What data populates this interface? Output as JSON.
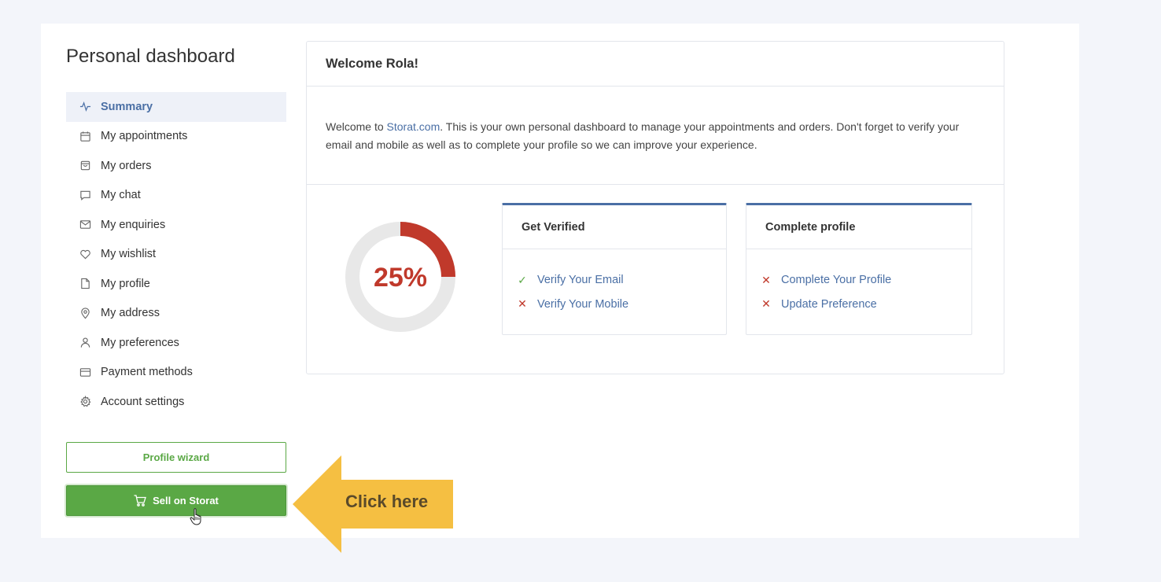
{
  "sidebar": {
    "title": "Personal dashboard",
    "items": [
      {
        "label": "Summary",
        "icon": "activity-icon",
        "active": true
      },
      {
        "label": "My appointments",
        "icon": "calendar-icon"
      },
      {
        "label": "My orders",
        "icon": "shopping-bag-icon"
      },
      {
        "label": "My chat",
        "icon": "chat-icon"
      },
      {
        "label": "My enquiries",
        "icon": "mail-icon"
      },
      {
        "label": "My wishlist",
        "icon": "heart-icon"
      },
      {
        "label": "My profile",
        "icon": "file-icon"
      },
      {
        "label": "My address",
        "icon": "map-pin-icon"
      },
      {
        "label": "My preferences",
        "icon": "user-icon"
      },
      {
        "label": "Payment methods",
        "icon": "credit-card-icon"
      },
      {
        "label": "Account settings",
        "icon": "gear-icon"
      }
    ],
    "profile_wizard_label": "Profile wizard",
    "sell_label": "Sell on Storat"
  },
  "callout": {
    "text": "Click here",
    "color": "#f5bf42"
  },
  "welcome": {
    "title": "Welcome Rola!",
    "text_before": "Welcome to ",
    "link": "Storat.com",
    "text_after": ". This is your own personal dashboard to manage your appointments and orders. Don't forget to verify your email and mobile as well as to complete your profile so we can improve your experience."
  },
  "progress": {
    "value": 25,
    "label": "25%",
    "color": "#c0392b"
  },
  "verify_card": {
    "title": "Get Verified",
    "items": [
      {
        "label": "Verify Your Email",
        "done": true
      },
      {
        "label": "Verify Your Mobile",
        "done": false
      }
    ]
  },
  "profile_card": {
    "title": "Complete profile",
    "items": [
      {
        "label": "Complete Your Profile",
        "done": false
      },
      {
        "label": "Update Preference",
        "done": false
      }
    ]
  },
  "colors": {
    "accent": "#4a6fa5",
    "success": "#5aa845",
    "danger": "#c0392b"
  }
}
